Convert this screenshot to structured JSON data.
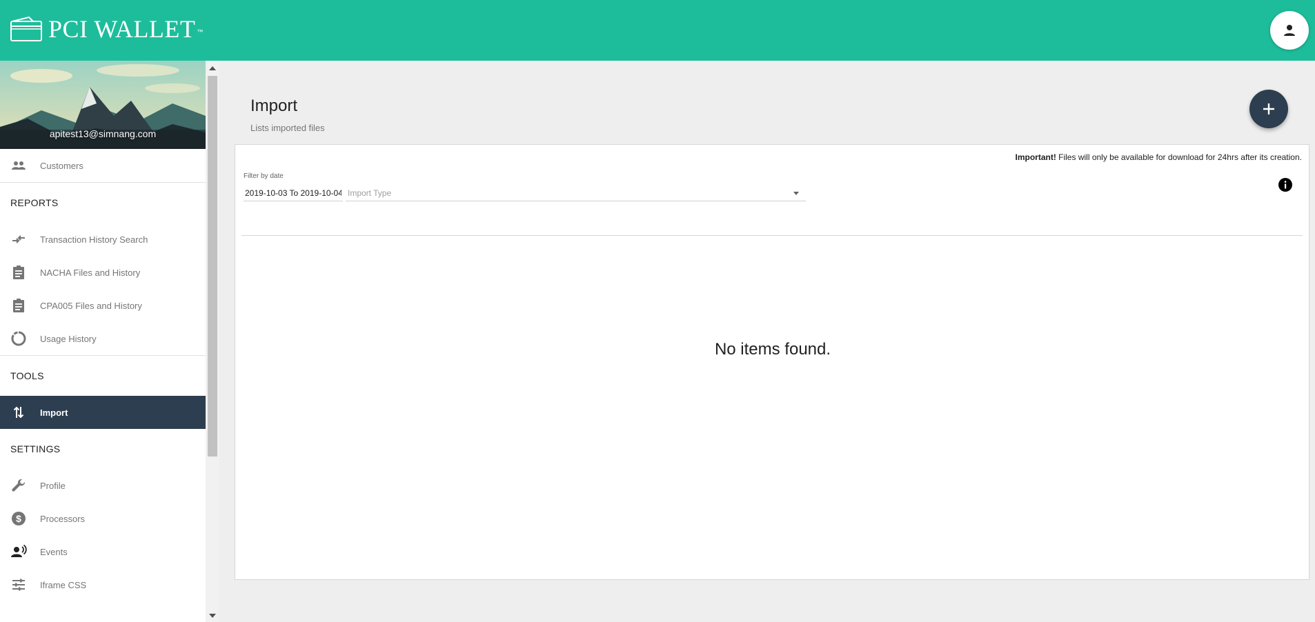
{
  "app": {
    "logo_text": "PCI WALLET",
    "logo_tm": "™",
    "accent_color": "#1dbd9b",
    "nav_dark_color": "#2d3e50"
  },
  "sidebar": {
    "user_email": "apitest13@simnang.com",
    "customers": {
      "label": "Customers",
      "icon": "people-icon"
    },
    "reports": {
      "heading": "REPORTS",
      "items": [
        {
          "label": "Transaction History Search",
          "icon": "compare-arrows-icon"
        },
        {
          "label": "NACHA Files and History",
          "icon": "clipboard-icon"
        },
        {
          "label": "CPA005 Files and History",
          "icon": "clipboard-icon"
        },
        {
          "label": "Usage History",
          "icon": "donut-icon"
        }
      ]
    },
    "tools": {
      "heading": "TOOLS",
      "items": [
        {
          "label": "Import",
          "icon": "import-export-icon",
          "active": true
        }
      ]
    },
    "settings": {
      "heading": "SETTINGS",
      "items": [
        {
          "label": "Profile",
          "icon": "wrench-icon"
        },
        {
          "label": "Processors",
          "icon": "dollar-circle-icon"
        },
        {
          "label": "Events",
          "icon": "record-voice-icon"
        },
        {
          "label": "Iframe CSS",
          "icon": "tune-icon"
        }
      ]
    }
  },
  "main": {
    "title": "Import",
    "subtitle": "Lists imported files",
    "notice_bold": "Important!",
    "notice_text": " Files will only be available for download for 24hrs after its creation.",
    "filter_label": "Filter by date",
    "date_value": "2019-10-03 To 2019-10-04",
    "import_type_placeholder": "Import Type",
    "empty_text": "No items found."
  }
}
